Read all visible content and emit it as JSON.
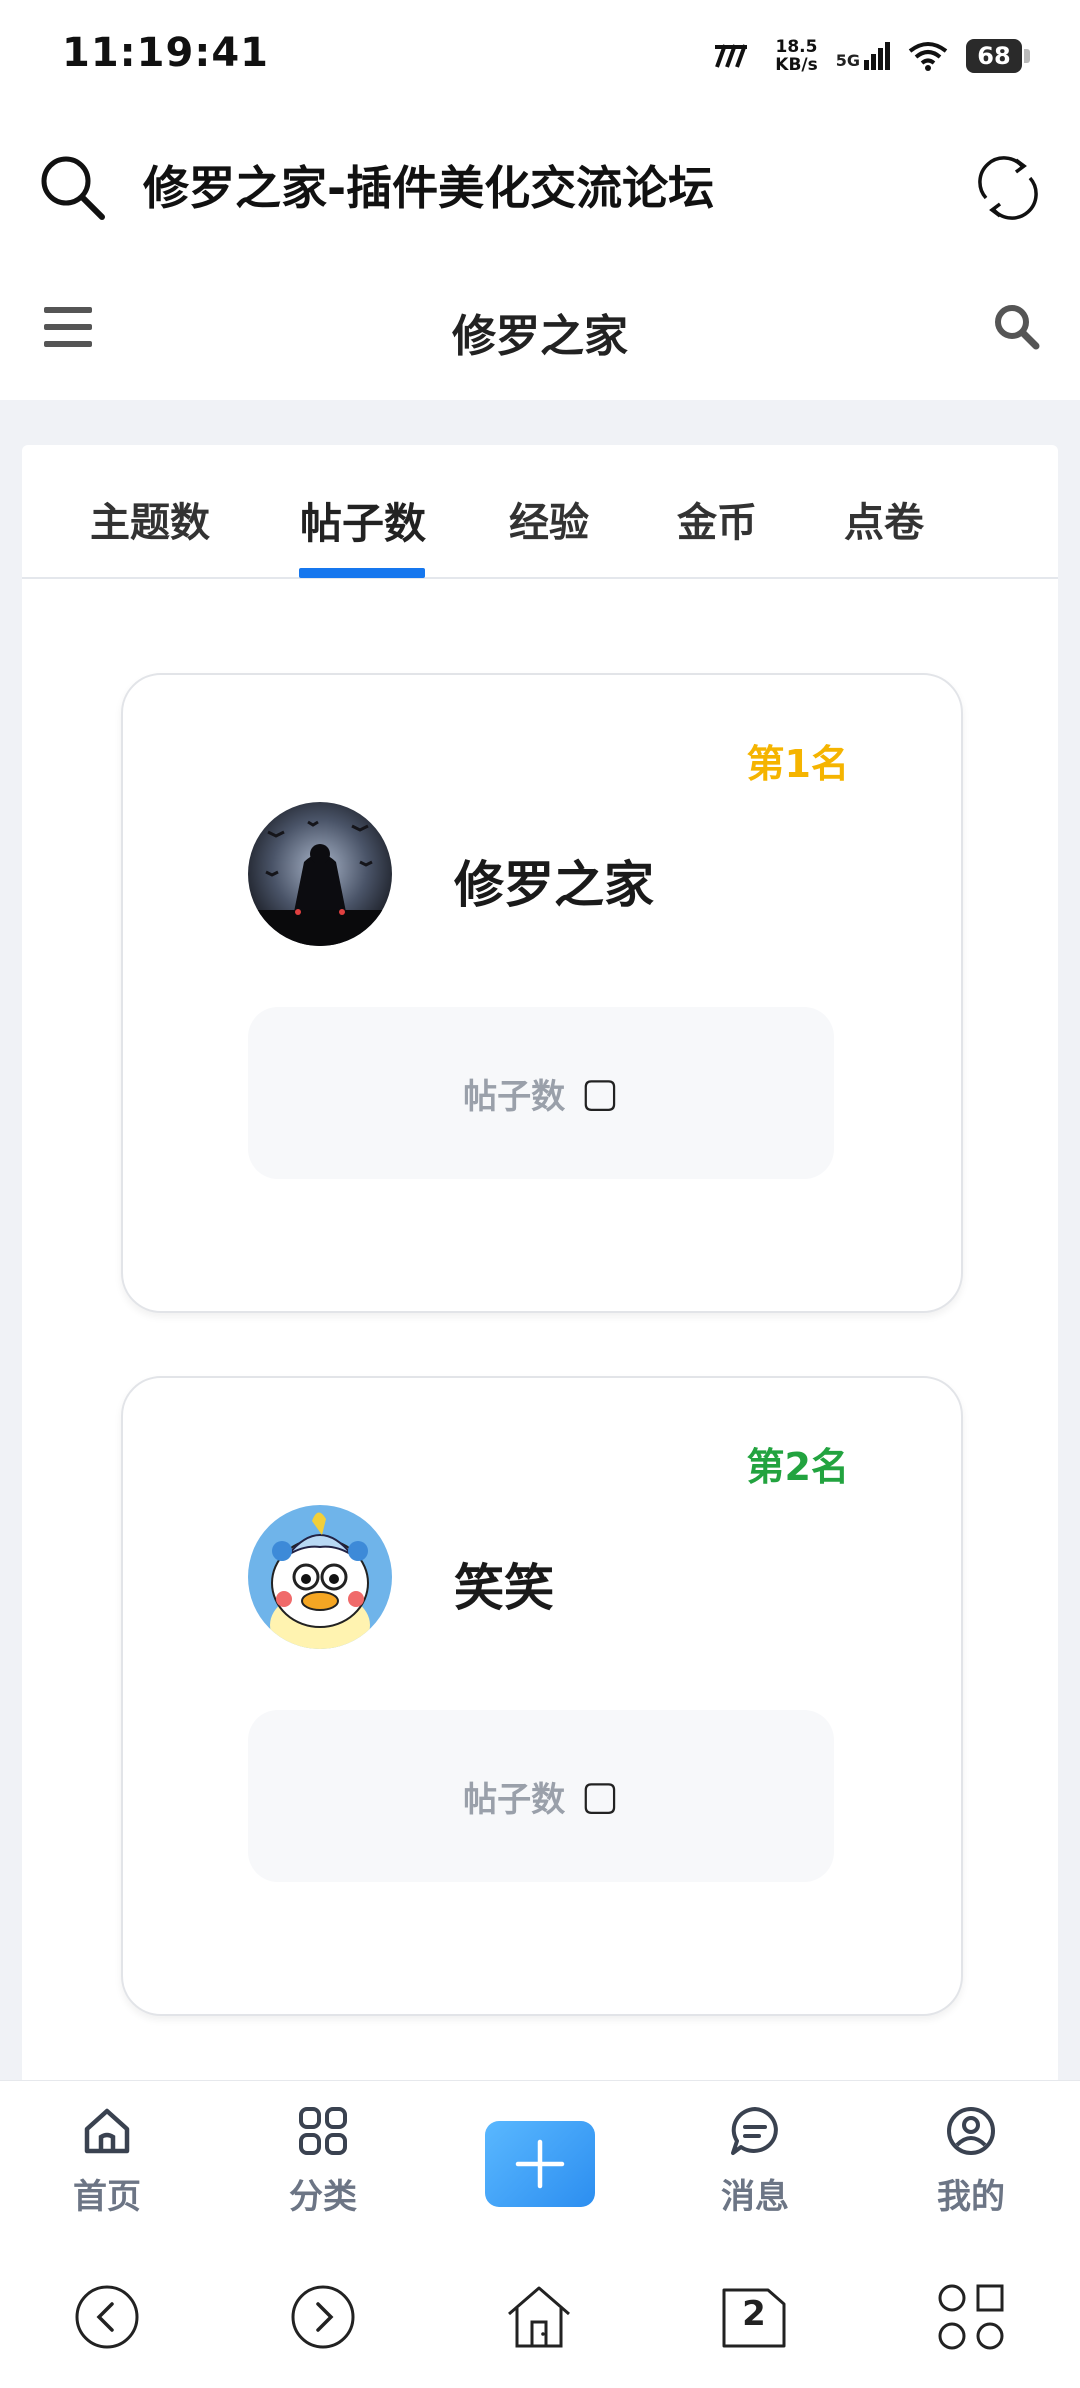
{
  "status_bar": {
    "time": "11:19:41",
    "net_speed_value": "18.5",
    "net_speed_unit": "KB/s",
    "network": "5G",
    "battery": "68"
  },
  "browser": {
    "page_title": "修罗之家-插件美化交流论坛"
  },
  "app_header": {
    "title": "修罗之家"
  },
  "tabs": [
    {
      "label": "主题数",
      "active": false
    },
    {
      "label": "帖子数",
      "active": true
    },
    {
      "label": "经验",
      "active": false
    },
    {
      "label": "金币",
      "active": false
    },
    {
      "label": "点卷",
      "active": false
    }
  ],
  "ranking": [
    {
      "rank": "第1名",
      "rank_color": "#f5b400",
      "name": "修罗之家",
      "stat_label": "帖子数",
      "stat_value": "▢"
    },
    {
      "rank": "第2名",
      "rank_color": "#22a33f",
      "name": "笑笑",
      "stat_label": "帖子数",
      "stat_value": "▢"
    }
  ],
  "bottom_nav": [
    {
      "label": "首页",
      "icon": "home-icon"
    },
    {
      "label": "分类",
      "icon": "grid-icon"
    },
    {
      "label": "",
      "icon": "plus-icon"
    },
    {
      "label": "消息",
      "icon": "message-icon"
    },
    {
      "label": "我的",
      "icon": "profile-icon"
    }
  ],
  "system_nav": {
    "tab_count": "2"
  },
  "colors": {
    "accent": "#1677ee",
    "rank1": "#f5b400",
    "rank2": "#22a33f"
  }
}
